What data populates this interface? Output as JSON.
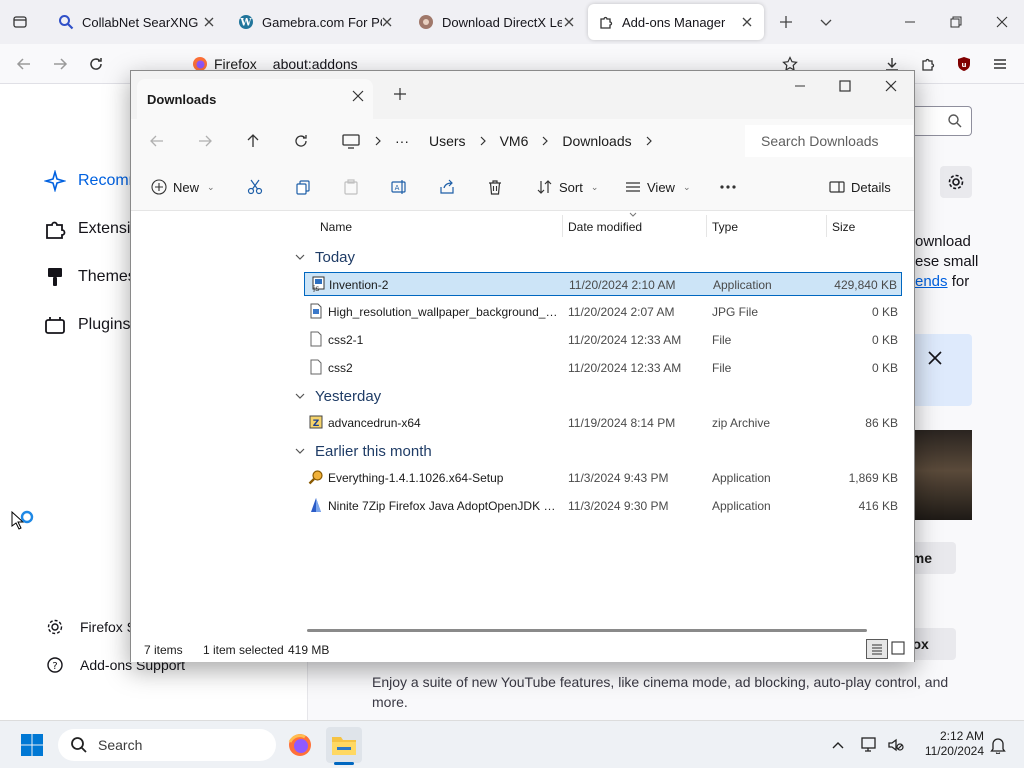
{
  "browser": {
    "tabs": [
      {
        "title": "CollabNet SearXNG",
        "icon": "search-icon"
      },
      {
        "title": "Gamebra.com For PC V",
        "icon": "wordpress-icon"
      },
      {
        "title": "Download DirectX Leg",
        "icon": "page-icon"
      },
      {
        "title": "Add-ons Manager",
        "icon": "puzzle-icon"
      }
    ],
    "url_badge": "Firefox",
    "url": "about:addons"
  },
  "addons": {
    "categories": [
      "Recomm",
      "Extensi",
      "Themes",
      "Plugins"
    ],
    "footer": {
      "settings": "Firefox S",
      "support": "Add-ons Support"
    },
    "bg_text": {
      "line1": "ownload",
      "line2": "ese small",
      "line3_link": "ends",
      "line3_rest": "for",
      "fragment_s": "s",
      "theme_btn": "eme",
      "firefox_btn": "efox",
      "youtube_1": "Enjoy a suite of new YouTube features, like cinema mode, ad blocking, auto-play control, and",
      "youtube_2": "more."
    }
  },
  "explorer": {
    "tab_title": "Downloads",
    "breadcrumb": [
      "Users",
      "VM6",
      "Downloads"
    ],
    "search_placeholder": "Search Downloads",
    "toolbar": {
      "new": "New",
      "sort": "Sort",
      "view": "View",
      "details": "Details"
    },
    "columns": {
      "name": "Name",
      "date": "Date modified",
      "type": "Type",
      "size": "Size"
    },
    "groups": [
      {
        "label": "Today",
        "files": [
          {
            "name": "Invention-2",
            "date": "11/20/2024 2:10 AM",
            "type": "Application",
            "size": "429,840 KB",
            "icon": "application-icon",
            "selected": true
          },
          {
            "name": "High_resolution_wallpaper_background_I...",
            "date": "11/20/2024 2:07 AM",
            "type": "JPG File",
            "size": "0 KB",
            "icon": "image-file-icon"
          },
          {
            "name": "css2-1",
            "date": "11/20/2024 12:33 AM",
            "type": "File",
            "size": "0 KB",
            "icon": "file-icon"
          },
          {
            "name": "css2",
            "date": "11/20/2024 12:33 AM",
            "type": "File",
            "size": "0 KB",
            "icon": "file-icon"
          }
        ]
      },
      {
        "label": "Yesterday",
        "files": [
          {
            "name": "advancedrun-x64",
            "date": "11/19/2024 8:14 PM",
            "type": "zip Archive",
            "size": "86 KB",
            "icon": "zip-icon"
          }
        ]
      },
      {
        "label": "Earlier this month",
        "files": [
          {
            "name": "Everything-1.4.1.1026.x64-Setup",
            "date": "11/3/2024 9:43 PM",
            "type": "Application",
            "size": "1,869 KB",
            "icon": "magnifier-app-icon"
          },
          {
            "name": "Ninite 7Zip Firefox Java AdoptOpenJDK x...",
            "date": "11/3/2024 9:30 PM",
            "type": "Application",
            "size": "416 KB",
            "icon": "ninite-icon"
          }
        ]
      }
    ],
    "status": {
      "items": "7 items",
      "selection": "1 item selected",
      "sel_size": "419 MB"
    }
  },
  "taskbar": {
    "search_placeholder": "Search",
    "time": "2:12 AM",
    "date": "11/20/2024"
  },
  "colors": {
    "accent": "#0067c0",
    "selection": "#cce4f7",
    "firefox_blue": "#0061e0"
  }
}
